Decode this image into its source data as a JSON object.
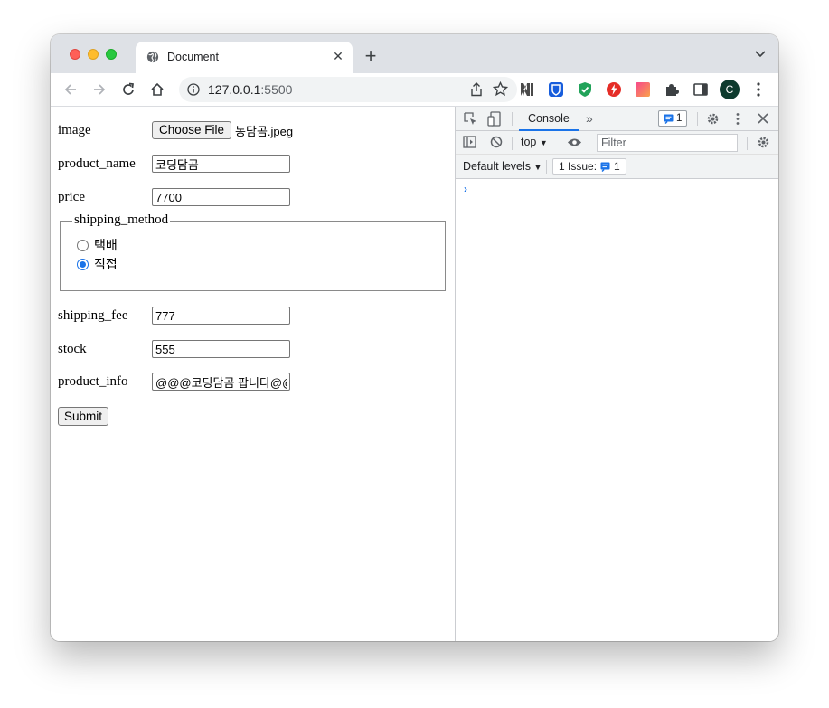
{
  "browser": {
    "tab_title": "Document",
    "url_host": "127.0.0.1",
    "url_port": ":5500",
    "profile_initial": "C"
  },
  "form": {
    "image_label": "image",
    "choose_file_label": "Choose File",
    "file_name": "농담곰.jpeg",
    "product_name_label": "product_name",
    "product_name_value": "코딩담곰",
    "price_label": "price",
    "price_value": "7700",
    "shipping_method_legend": "shipping_method",
    "shipping_options": [
      "택배",
      "직접"
    ],
    "shipping_selected": "직접",
    "shipping_fee_label": "shipping_fee",
    "shipping_fee_value": "777",
    "stock_label": "stock",
    "stock_value": "555",
    "product_info_label": "product_info",
    "product_info_value": "@@@코딩담곰 팝니다@@@",
    "submit_label": "Submit"
  },
  "devtools": {
    "console_tab": "Console",
    "message_count": "1",
    "context": "top",
    "filter_placeholder": "Filter",
    "levels": "Default levels",
    "issue_text": "1 Issue:",
    "issue_count": "1",
    "prompt_symbol": "›"
  },
  "colors": {
    "accent": "#1a73e8",
    "tabstrip": "#dee1e6",
    "avatar": "#0e3b2e"
  }
}
